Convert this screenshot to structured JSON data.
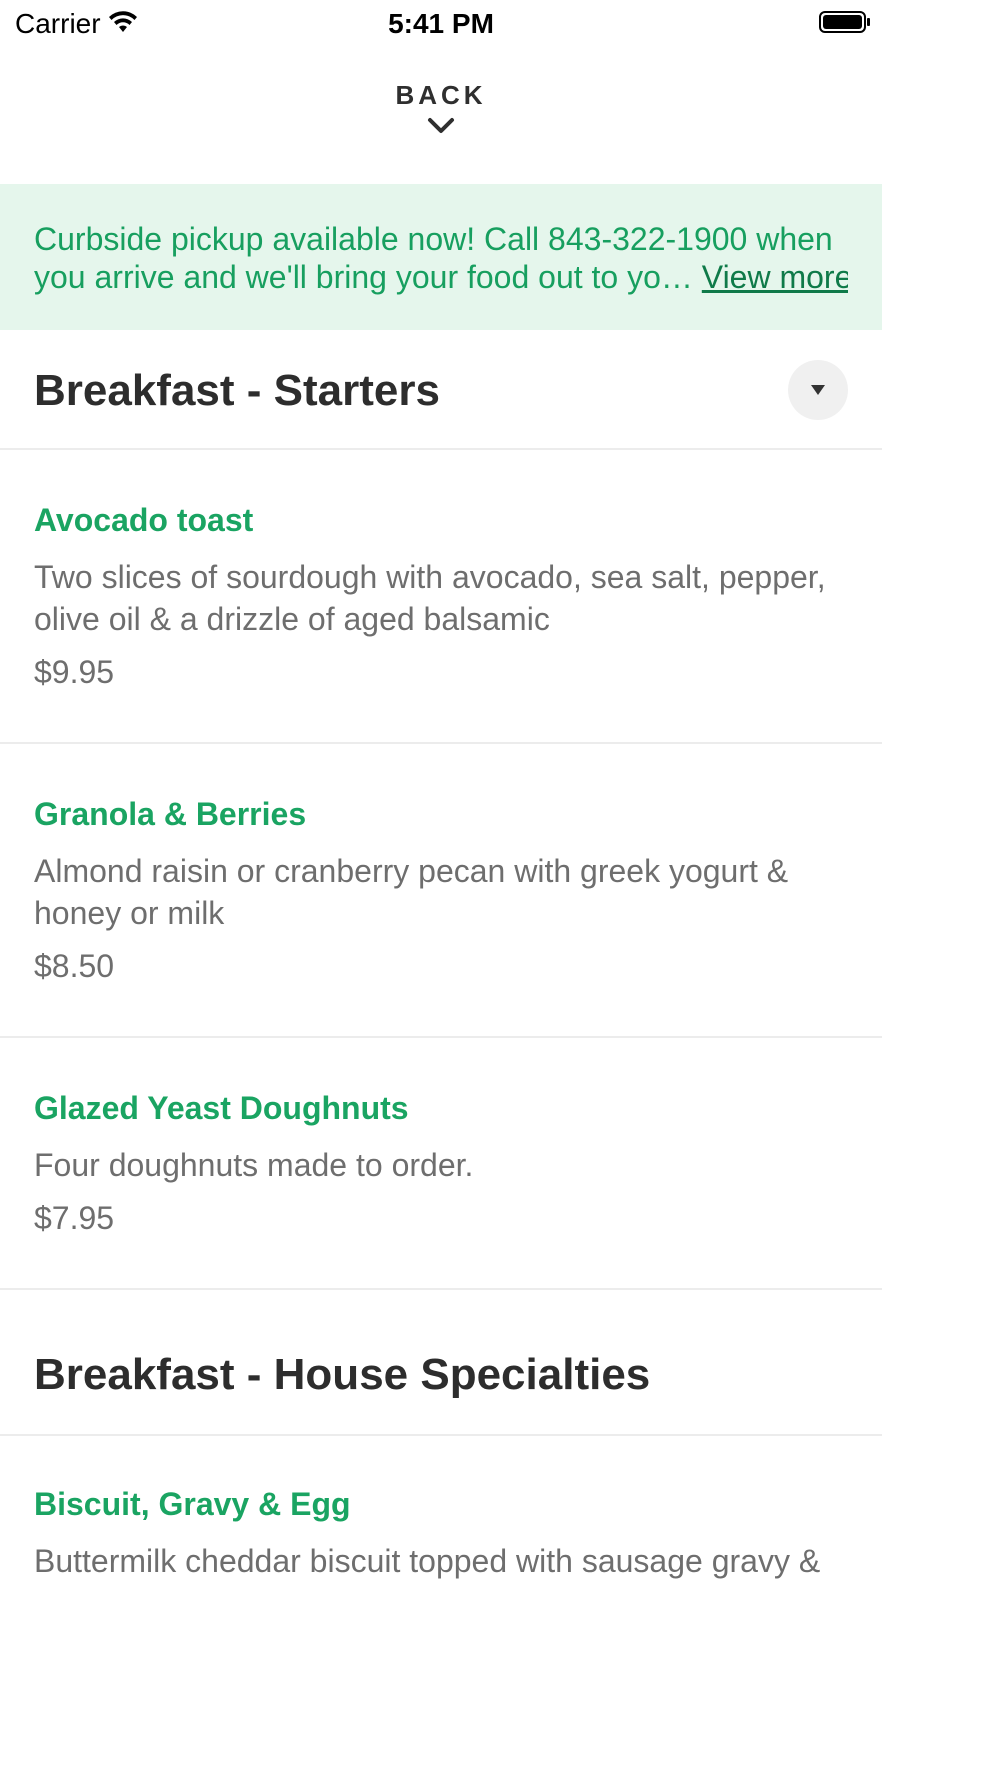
{
  "status_bar": {
    "carrier": "Carrier",
    "time": "5:41 PM"
  },
  "nav": {
    "back_label": "BACK"
  },
  "banner": {
    "line1": "Curbside pickup available now! Call 843-322-1900 when",
    "line2": "you arrive and we'll bring your food out to yo…",
    "more_label": "View more"
  },
  "sections": [
    {
      "title": "Breakfast - Starters",
      "items": [
        {
          "name": "Avocado toast",
          "description": "Two slices of sourdough with avocado, sea salt, pepper, olive oil & a drizzle of aged balsamic",
          "price": "$9.95"
        },
        {
          "name": "Granola & Berries",
          "description": "Almond raisin or cranberry pecan with greek yogurt & honey or milk",
          "price": "$8.50"
        },
        {
          "name": "Glazed Yeast Doughnuts",
          "description": "Four doughnuts made to order.",
          "price": "$7.95"
        }
      ]
    },
    {
      "title": "Breakfast - House Specialties",
      "items": [
        {
          "name": "Biscuit, Gravy & Egg",
          "description": "Buttermilk cheddar biscuit topped with sausage gravy &"
        }
      ]
    }
  ],
  "colors": {
    "accent_green": "#1aa462",
    "banner_bg": "#e5f6ec"
  }
}
